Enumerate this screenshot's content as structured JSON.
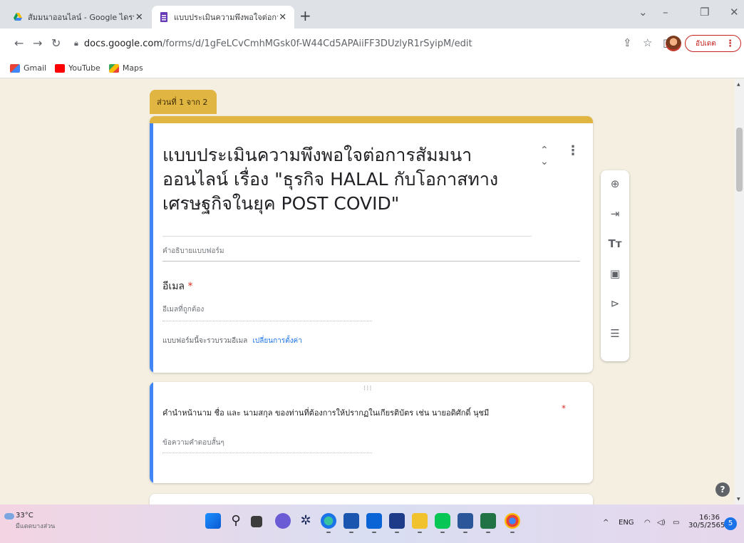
{
  "browser": {
    "tabs": [
      {
        "title": "สัมมนาออนไลน์ - Google ไดรฟ์",
        "icon": "google-drive-icon",
        "active": false
      },
      {
        "title": "แบบประเมินความพึงพอใจต่อการสัมมน",
        "icon": "google-forms-icon",
        "active": true
      }
    ],
    "url_host": "docs.google.com",
    "url_path": "/forms/d/1gFeLCvCmhMGsk0f-W44Cd5APAiiFF3DUzlyR1rSyipM/edit",
    "update_label": "อัปเดต",
    "bookmarks": [
      {
        "label": "Gmail",
        "icon": "gmail-icon"
      },
      {
        "label": "YouTube",
        "icon": "youtube-icon"
      },
      {
        "label": "Maps",
        "icon": "maps-icon"
      }
    ]
  },
  "form": {
    "section_tag": "ส่วนที่ 1 จาก 2",
    "title": "แบบประเมินความพึงพอใจต่อการสัมมนาออนไลน์ เรื่อง \"ธุรกิจ HALAL กับโอกาสทางเศรษฐกิจในยุค POST COVID\"",
    "description_placeholder": "คำอธิบายแบบฟอร์ม",
    "email_label": "อีเมล",
    "required_mark": "*",
    "email_placeholder": "อีเมลที่ถูกต้อง",
    "email_note": "แบบฟอร์มนี้จะรวบรวมอีเมล",
    "email_note_link": "เปลี่ยนการตั้งค่า",
    "question_text": "คำนำหน้านาม ชื่อ และ นามสกุล ของท่านที่ต้องการให้ปรากฏในเกียรติบัตร เช่น นายอดิศักดิ์ นุชมี",
    "question_placeholder": "ข้อความคำตอบสั้นๆ",
    "tools": [
      "add-question-icon",
      "import-questions-icon",
      "add-title-icon",
      "add-image-icon",
      "add-video-icon",
      "add-section-icon"
    ]
  },
  "taskbar": {
    "temperature": "33°C",
    "weather_text": "มีแดดบางส่วน",
    "lang": "ENG",
    "time": "16:36",
    "date": "30/5/2565",
    "notification_count": "5"
  }
}
